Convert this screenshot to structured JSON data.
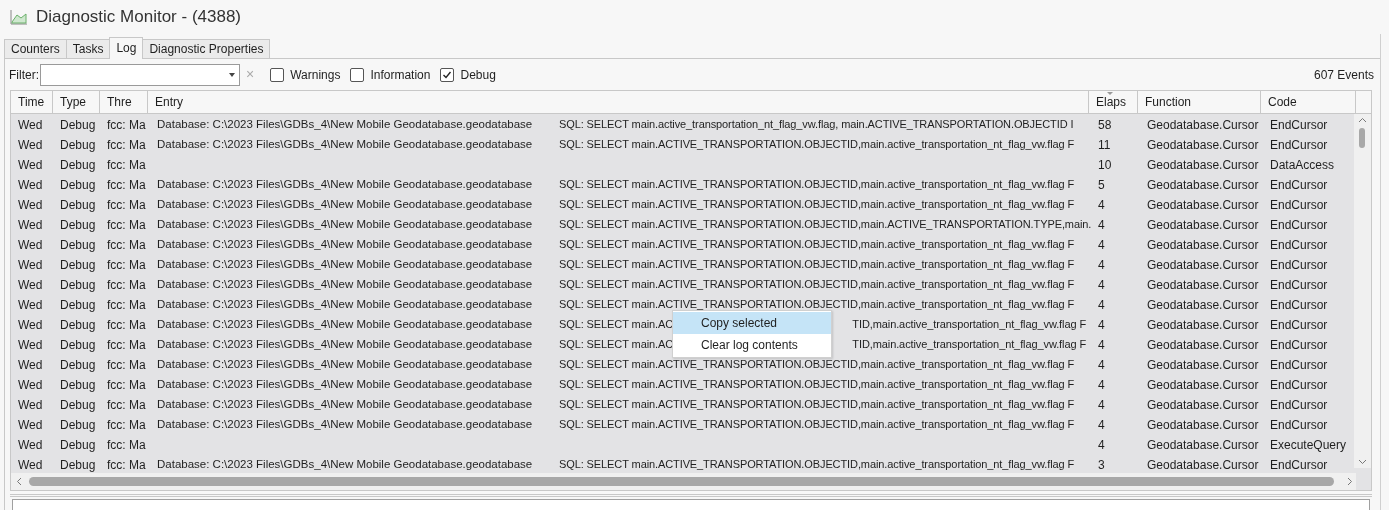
{
  "window": {
    "title": "Diagnostic Monitor - (4388)"
  },
  "tabs": [
    {
      "label": "Counters",
      "selected": false
    },
    {
      "label": "Tasks",
      "selected": false
    },
    {
      "label": "Log",
      "selected": true
    },
    {
      "label": "Diagnostic Properties",
      "selected": false
    }
  ],
  "filter": {
    "label": "Filter:",
    "clear": "×"
  },
  "checkboxes": [
    {
      "label": "Warnings",
      "checked": false
    },
    {
      "label": "Information",
      "checked": false
    },
    {
      "label": "Debug",
      "checked": true
    }
  ],
  "event_count": "607 Events",
  "table": {
    "columns": [
      "Time",
      "Type",
      "Thre",
      "Entry",
      "Elaps",
      "Function",
      "Code"
    ],
    "rows": [
      {
        "time": "Wed",
        "type": "Debug",
        "thread": "fcc: Ma",
        "database": "Database: C:\\2023 Files\\GDBs_4\\New Mobile Geodatabase.geodatabase",
        "sql": "SQL: SELECT main.active_transportation_nt_flag_vw.flag, main.ACTIVE_TRANSPORTATION.OBJECTID I",
        "elapsed": "58",
        "function": "Geodatabase.Cursor",
        "code": "EndCursor"
      },
      {
        "time": "Wed",
        "type": "Debug",
        "thread": "fcc: Ma",
        "database": "Database: C:\\2023 Files\\GDBs_4\\New Mobile Geodatabase.geodatabase",
        "sql": "SQL: SELECT main.ACTIVE_TRANSPORTATION.OBJECTID,main.active_transportation_nt_flag_vw.flag F",
        "elapsed": "11",
        "function": "Geodatabase.Cursor",
        "code": "EndCursor"
      },
      {
        "time": "Wed",
        "type": "Debug",
        "thread": "fcc: Ma",
        "elapsed": "10",
        "function": "Geodatabase.Cursor",
        "code": "DataAccess"
      },
      {
        "time": "Wed",
        "type": "Debug",
        "thread": "fcc: Ma",
        "database": "Database: C:\\2023 Files\\GDBs_4\\New Mobile Geodatabase.geodatabase",
        "sql": "SQL: SELECT main.ACTIVE_TRANSPORTATION.OBJECTID,main.active_transportation_nt_flag_vw.flag F",
        "elapsed": "5",
        "function": "Geodatabase.Cursor",
        "code": "EndCursor"
      },
      {
        "time": "Wed",
        "type": "Debug",
        "thread": "fcc: Ma",
        "database": "Database: C:\\2023 Files\\GDBs_4\\New Mobile Geodatabase.geodatabase",
        "sql": "SQL: SELECT main.ACTIVE_TRANSPORTATION.OBJECTID,main.active_transportation_nt_flag_vw.flag F",
        "elapsed": "4",
        "function": "Geodatabase.Cursor",
        "code": "EndCursor"
      },
      {
        "time": "Wed",
        "type": "Debug",
        "thread": "fcc: Ma",
        "database": "Database: C:\\2023 Files\\GDBs_4\\New Mobile Geodatabase.geodatabase",
        "sql": "SQL: SELECT main.ACTIVE_TRANSPORTATION.OBJECTID,main.ACTIVE_TRANSPORTATION.TYPE,main.",
        "elapsed": "4",
        "function": "Geodatabase.Cursor",
        "code": "EndCursor"
      },
      {
        "time": "Wed",
        "type": "Debug",
        "thread": "fcc: Ma",
        "database": "Database: C:\\2023 Files\\GDBs_4\\New Mobile Geodatabase.geodatabase",
        "sql": "SQL: SELECT main.ACTIVE_TRANSPORTATION.OBJECTID,main.active_transportation_nt_flag_vw.flag F",
        "elapsed": "4",
        "function": "Geodatabase.Cursor",
        "code": "EndCursor"
      },
      {
        "time": "Wed",
        "type": "Debug",
        "thread": "fcc: Ma",
        "database": "Database: C:\\2023 Files\\GDBs_4\\New Mobile Geodatabase.geodatabase",
        "sql": "SQL: SELECT main.ACTIVE_TRANSPORTATION.OBJECTID,main.active_transportation_nt_flag_vw.flag F",
        "elapsed": "4",
        "function": "Geodatabase.Cursor",
        "code": "EndCursor"
      },
      {
        "time": "Wed",
        "type": "Debug",
        "thread": "fcc: Ma",
        "database": "Database: C:\\2023 Files\\GDBs_4\\New Mobile Geodatabase.geodatabase",
        "sql": "SQL: SELECT main.ACTIVE_TRANSPORTATION.OBJECTID,main.active_transportation_nt_flag_vw.flag F",
        "elapsed": "4",
        "function": "Geodatabase.Cursor",
        "code": "EndCursor"
      },
      {
        "time": "Wed",
        "type": "Debug",
        "thread": "fcc: Ma",
        "database": "Database: C:\\2023 Files\\GDBs_4\\New Mobile Geodatabase.geodatabase",
        "sql": "SQL: SELECT main.ACTIVE_TRANSPORTATION.OBJECTID,main.active_transportation_nt_flag_vw.flag F",
        "elapsed": "4",
        "function": "Geodatabase.Cursor",
        "code": "EndCursor"
      },
      {
        "time": "Wed",
        "type": "Debug",
        "thread": "fcc: Ma",
        "database": "Database: C:\\2023 Files\\GDBs_4\\New Mobile Geodatabase.geodatabase",
        "sql": "SQL: SELECT main.AC",
        "sql_tail": "TID,main.active_transportation_nt_flag_vw.flag F",
        "elapsed": "4",
        "function": "Geodatabase.Cursor",
        "code": "EndCursor"
      },
      {
        "time": "Wed",
        "type": "Debug",
        "thread": "fcc: Ma",
        "database": "Database: C:\\2023 Files\\GDBs_4\\New Mobile Geodatabase.geodatabase",
        "sql": "SQL: SELECT main.AC",
        "sql_tail": "TID,main.active_transportation_nt_flag_vw.flag F",
        "elapsed": "4",
        "function": "Geodatabase.Cursor",
        "code": "EndCursor"
      },
      {
        "time": "Wed",
        "type": "Debug",
        "thread": "fcc: Ma",
        "database": "Database: C:\\2023 Files\\GDBs_4\\New Mobile Geodatabase.geodatabase",
        "sql": "SQL: SELECT main.ACTIVE_TRANSPORTATION.OBJECTID,main.active_transportation_nt_flag_vw.flag F",
        "elapsed": "4",
        "function": "Geodatabase.Cursor",
        "code": "EndCursor"
      },
      {
        "time": "Wed",
        "type": "Debug",
        "thread": "fcc: Ma",
        "database": "Database: C:\\2023 Files\\GDBs_4\\New Mobile Geodatabase.geodatabase",
        "sql": "SQL: SELECT main.ACTIVE_TRANSPORTATION.OBJECTID,main.active_transportation_nt_flag_vw.flag F",
        "elapsed": "4",
        "function": "Geodatabase.Cursor",
        "code": "EndCursor"
      },
      {
        "time": "Wed",
        "type": "Debug",
        "thread": "fcc: Ma",
        "database": "Database: C:\\2023 Files\\GDBs_4\\New Mobile Geodatabase.geodatabase",
        "sql": "SQL: SELECT main.ACTIVE_TRANSPORTATION.OBJECTID,main.active_transportation_nt_flag_vw.flag F",
        "elapsed": "4",
        "function": "Geodatabase.Cursor",
        "code": "EndCursor"
      },
      {
        "time": "Wed",
        "type": "Debug",
        "thread": "fcc: Ma",
        "database": "Database: C:\\2023 Files\\GDBs_4\\New Mobile Geodatabase.geodatabase",
        "sql": "SQL: SELECT main.ACTIVE_TRANSPORTATION.OBJECTID,main.active_transportation_nt_flag_vw.flag F",
        "elapsed": "4",
        "function": "Geodatabase.Cursor",
        "code": "EndCursor"
      },
      {
        "time": "Wed",
        "type": "Debug",
        "thread": "fcc: Ma",
        "elapsed": "4",
        "function": "Geodatabase.Cursor",
        "code": "ExecuteQuery"
      },
      {
        "time": "Wed",
        "type": "Debug",
        "thread": "fcc: Ma",
        "database": "Database: C:\\2023 Files\\GDBs_4\\New Mobile Geodatabase.geodatabase",
        "sql": "SQL: SELECT main.ACTIVE_TRANSPORTATION.OBJECTID,main.active_transportation_nt_flag_vw.flag F",
        "elapsed": "3",
        "function": "Geodatabase.Cursor",
        "code": "EndCursor"
      }
    ]
  },
  "context_menu": {
    "items": [
      {
        "label": "Copy selected",
        "selected": true
      },
      {
        "label": "Clear log contents",
        "selected": false
      }
    ]
  }
}
